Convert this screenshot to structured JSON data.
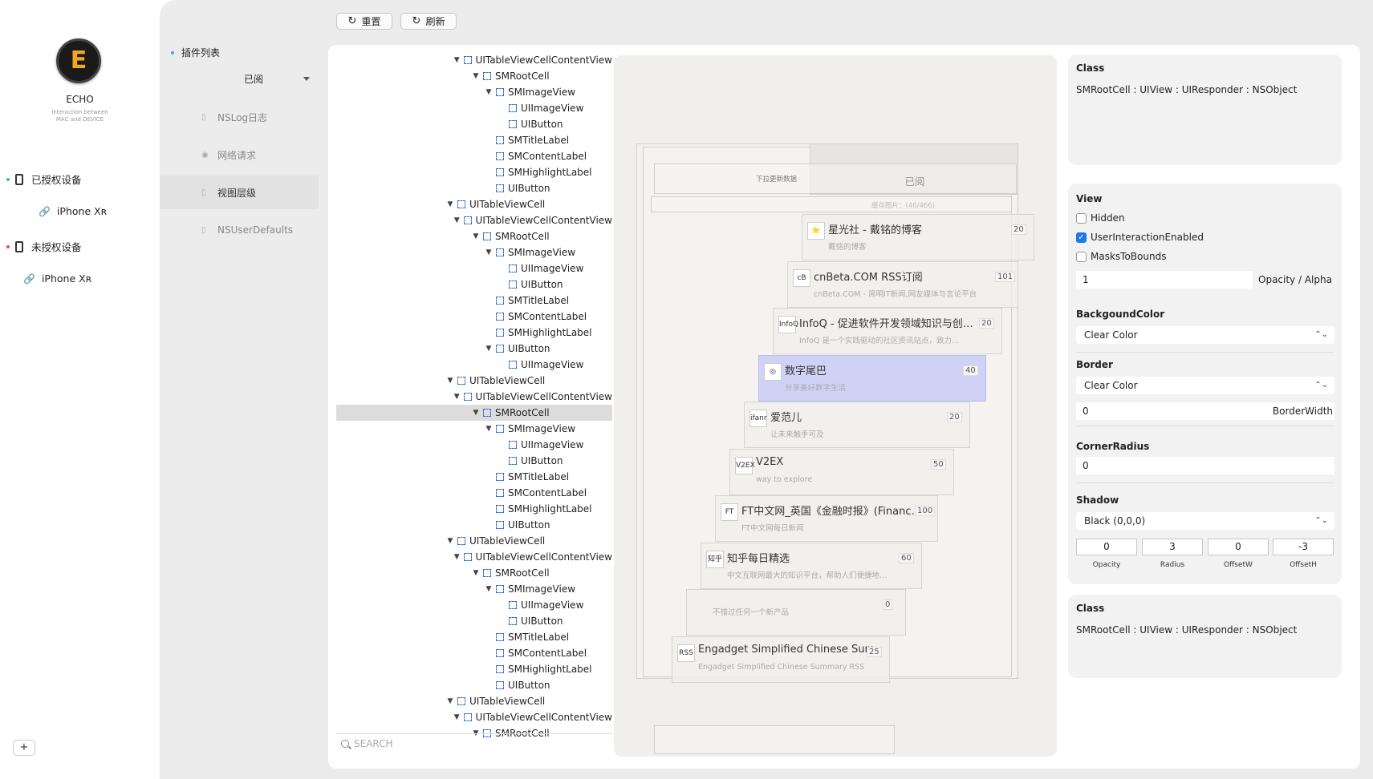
{
  "app": {
    "name": "ECHO",
    "subtitle_line1": "Interaction between",
    "subtitle_line2": "MAC and DEVICE",
    "logo_letter": "E",
    "add_label": "+"
  },
  "devices": {
    "authorized": {
      "label": "已授权设备",
      "dot_color": "#35b6c8",
      "items": [
        {
          "name": "iPhone Xʀ"
        }
      ]
    },
    "unauthorized": {
      "label": "未授权设备",
      "dot_color": "#e8505b",
      "items": [
        {
          "name": "iPhone Xʀ"
        }
      ]
    }
  },
  "plugins": {
    "title": "插件列表",
    "filter": "已阅",
    "items": [
      {
        "label": "NSLog日志",
        "icon": "doc-icon"
      },
      {
        "label": "网络请求",
        "icon": "globe-icon"
      },
      {
        "label": "视图层级",
        "icon": "doc-icon",
        "active": true
      },
      {
        "label": "NSUserDefaults",
        "icon": "doc-icon"
      }
    ]
  },
  "toolbar": {
    "reset_label": "重置",
    "refresh_label": "刷新"
  },
  "tree": [
    {
      "indent": 0,
      "arrow": true,
      "label": "UITableViewCellContentView"
    },
    {
      "indent": 1,
      "arrow": true,
      "label": "SMRootCell"
    },
    {
      "indent": 2,
      "arrow": true,
      "label": "SMImageView"
    },
    {
      "indent": 3,
      "arrow": false,
      "label": "UIImageView"
    },
    {
      "indent": 3,
      "arrow": false,
      "label": "UIButton"
    },
    {
      "indent": 2,
      "arrow": false,
      "label": "SMTitleLabel"
    },
    {
      "indent": 2,
      "arrow": false,
      "label": "SMContentLabel"
    },
    {
      "indent": 2,
      "arrow": false,
      "label": "SMHighlightLabel"
    },
    {
      "indent": 2,
      "arrow": false,
      "label": "UIButton"
    },
    {
      "indent": -1,
      "arrow": true,
      "label": "UITableViewCell"
    },
    {
      "indent": 0,
      "arrow": true,
      "label": "UITableViewCellContentView"
    },
    {
      "indent": 1,
      "arrow": true,
      "label": "SMRootCell"
    },
    {
      "indent": 2,
      "arrow": true,
      "label": "SMImageView"
    },
    {
      "indent": 3,
      "arrow": false,
      "label": "UIImageView"
    },
    {
      "indent": 3,
      "arrow": false,
      "label": "UIButton"
    },
    {
      "indent": 2,
      "arrow": false,
      "label": "SMTitleLabel"
    },
    {
      "indent": 2,
      "arrow": false,
      "label": "SMContentLabel"
    },
    {
      "indent": 2,
      "arrow": false,
      "label": "SMHighlightLabel"
    },
    {
      "indent": 2,
      "arrow": true,
      "label": "UIButton"
    },
    {
      "indent": 3,
      "arrow": false,
      "label": "UIImageView"
    },
    {
      "indent": -1,
      "arrow": true,
      "label": "UITableViewCell"
    },
    {
      "indent": 0,
      "arrow": true,
      "label": "UITableViewCellContentView"
    },
    {
      "indent": 1,
      "arrow": true,
      "label": "SMRootCell",
      "selected": true
    },
    {
      "indent": 2,
      "arrow": true,
      "label": "SMImageView"
    },
    {
      "indent": 3,
      "arrow": false,
      "label": "UIImageView"
    },
    {
      "indent": 3,
      "arrow": false,
      "label": "UIButton"
    },
    {
      "indent": 2,
      "arrow": false,
      "label": "SMTitleLabel"
    },
    {
      "indent": 2,
      "arrow": false,
      "label": "SMContentLabel"
    },
    {
      "indent": 2,
      "arrow": false,
      "label": "SMHighlightLabel"
    },
    {
      "indent": 2,
      "arrow": false,
      "label": "UIButton"
    },
    {
      "indent": -1,
      "arrow": true,
      "label": "UITableViewCell"
    },
    {
      "indent": 0,
      "arrow": true,
      "label": "UITableViewCellContentView"
    },
    {
      "indent": 1,
      "arrow": true,
      "label": "SMRootCell"
    },
    {
      "indent": 2,
      "arrow": true,
      "label": "SMImageView"
    },
    {
      "indent": 3,
      "arrow": false,
      "label": "UIImageView"
    },
    {
      "indent": 3,
      "arrow": false,
      "label": "UIButton"
    },
    {
      "indent": 2,
      "arrow": false,
      "label": "SMTitleLabel"
    },
    {
      "indent": 2,
      "arrow": false,
      "label": "SMContentLabel"
    },
    {
      "indent": 2,
      "arrow": false,
      "label": "SMHighlightLabel"
    },
    {
      "indent": 2,
      "arrow": false,
      "label": "UIButton"
    },
    {
      "indent": -1,
      "arrow": true,
      "label": "UITableViewCell"
    },
    {
      "indent": 0,
      "arrow": true,
      "label": "UITableViewCellContentView"
    },
    {
      "indent": 1,
      "arrow": true,
      "label": "SMRootCell"
    }
  ],
  "search": {
    "placeholder": "SEARCH"
  },
  "preview": {
    "nav_title": "已阅",
    "pull_text": "下拉更新数据",
    "loaded_text": "缓存图片：(46/466)",
    "cells": [
      {
        "icon": "⭐",
        "title": "星光社 - 戴铭的博客",
        "subtitle": "戴铭的博客",
        "count": "20"
      },
      {
        "icon": "cB",
        "title": "cnBeta.COM RSS订阅",
        "subtitle": "cnBeta.COM - 简明IT新闻,网友媒体与言论平台",
        "count": "101"
      },
      {
        "icon": "InfoQ",
        "title": "InfoQ - 促进软件开发领域知识与创…",
        "subtitle": "InfoQ 是一个实践驱动的社区资讯站点，致力…",
        "count": "20"
      },
      {
        "icon": "◎",
        "title": "数字尾巴",
        "subtitle": "分享美好数字生活",
        "count": "40",
        "highlight": true
      },
      {
        "icon": "ifanr",
        "title": "爱范儿",
        "subtitle": "让未来触手可及",
        "count": "20"
      },
      {
        "icon": "V2EX",
        "title": "V2EX",
        "subtitle": "way to explore",
        "count": "50"
      },
      {
        "icon": "FT",
        "title": "FT中文网_英国《金融时报》(Financ…",
        "subtitle": "FT中文网每日新闻",
        "count": "100"
      },
      {
        "icon": "知乎",
        "title": "知乎每日精选",
        "subtitle": "中文互联网最大的知识平台，帮助人们便捷地…",
        "count": "60"
      },
      {
        "icon": "",
        "title": "",
        "subtitle": "不错过任何一个新产品",
        "count": "0"
      },
      {
        "icon": "RSS",
        "title": "Engadget Simplified Chinese Summ…",
        "subtitle": "Engadget Simplified Chinese Summary RSS",
        "count": "25"
      }
    ]
  },
  "inspector": {
    "class_header": "Class",
    "class_value": "SMRootCell : UIView : UIResponder : NSObject",
    "view_header": "View",
    "hidden_label": "Hidden",
    "hidden": false,
    "uie_label": "UserInteractionEnabled",
    "uie": true,
    "mtb_label": "MasksToBounds",
    "mtb": false,
    "opacity_value": "1",
    "opacity_label": "Opacity / Alpha",
    "bg_header": "BackgoundColor",
    "bg_value": "Clear Color",
    "border_header": "Border",
    "border_value": "Clear Color",
    "border_width_value": "0",
    "border_width_label": "BorderWidth",
    "corner_header": "CornerRadius",
    "corner_value": "0",
    "shadow_header": "Shadow",
    "shadow_color": "Black (0,0,0)",
    "shadow_opacity": "0",
    "shadow_radius": "3",
    "shadow_offsetw": "0",
    "shadow_offseth": "-3",
    "shadow_opacity_label": "Opacity",
    "shadow_radius_label": "Radius",
    "shadow_offsetw_label": "OffsetW",
    "shadow_offseth_label": "OffsetH",
    "class2_header": "Class",
    "class2_value": "SMRootCell : UIView : UIResponder : NSObject"
  }
}
